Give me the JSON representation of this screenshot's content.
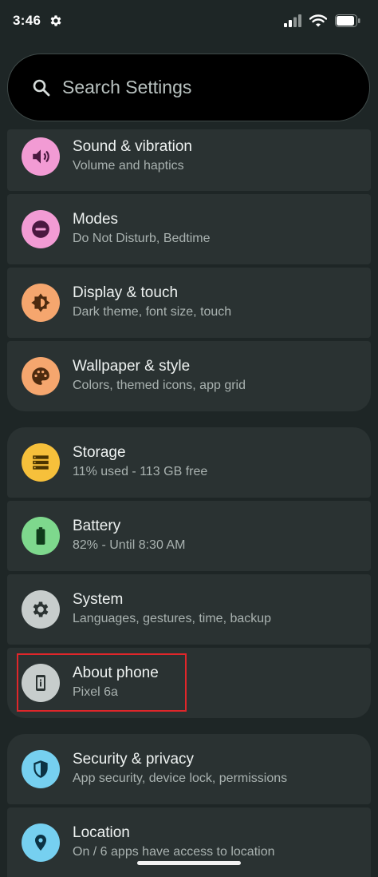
{
  "status_bar": {
    "time": "3:46",
    "icons": [
      "settings-gear-icon",
      "signal-icon",
      "wifi-icon",
      "battery-icon"
    ]
  },
  "search": {
    "placeholder": "Search Settings",
    "value": ""
  },
  "colors": {
    "background": "#1e2626",
    "card": "#2a3232",
    "highlight_border": "#e0262a"
  },
  "groups": [
    {
      "items": [
        {
          "title": "Sound & vibration",
          "subtitle": "Volume and haptics",
          "icon": "speaker-icon",
          "icon_color": "#f29bd4"
        },
        {
          "title": "Modes",
          "subtitle": "Do Not Disturb, Bedtime",
          "icon": "do-not-disturb-icon",
          "icon_color": "#f29bd4"
        },
        {
          "title": "Display & touch",
          "subtitle": "Dark theme, font size, touch",
          "icon": "brightness-icon",
          "icon_color": "#f5a66e"
        },
        {
          "title": "Wallpaper & style",
          "subtitle": "Colors, themed icons, app grid",
          "icon": "palette-icon",
          "icon_color": "#f5a66e"
        }
      ]
    },
    {
      "items": [
        {
          "title": "Storage",
          "subtitle": "11% used - 113 GB free",
          "icon": "storage-icon",
          "icon_color": "#f6c03b"
        },
        {
          "title": "Battery",
          "subtitle": "82% - Until 8:30 AM",
          "icon": "battery-full-icon",
          "icon_color": "#7ed88d"
        },
        {
          "title": "System",
          "subtitle": "Languages, gestures, time, backup",
          "icon": "gear-icon",
          "icon_color": "#c7cdcc"
        },
        {
          "title": "About phone",
          "subtitle": "Pixel 6a",
          "icon": "phone-info-icon",
          "icon_color": "#c7cdcc"
        }
      ]
    },
    {
      "items": [
        {
          "title": "Security & privacy",
          "subtitle": "App security, device lock, permissions",
          "icon": "shield-icon",
          "icon_color": "#76d0f0"
        },
        {
          "title": "Location",
          "subtitle": "On / 6 apps have access to location",
          "icon": "location-pin-icon",
          "icon_color": "#76d0f0"
        }
      ]
    }
  ]
}
